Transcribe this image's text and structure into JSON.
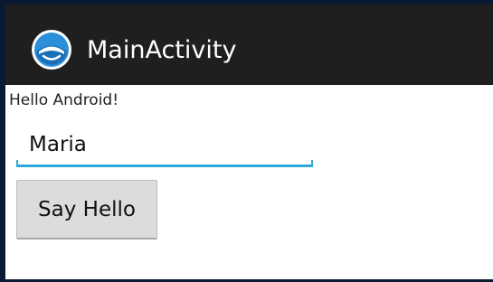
{
  "action_bar": {
    "title": "MainActivity",
    "icon": "app-launcher-icon",
    "background": "#1f1f1f"
  },
  "content": {
    "greeting": "Hello Android!",
    "name_field": {
      "value": "Maria",
      "accent": "#2fa9d6"
    },
    "button_label": "Say Hello"
  }
}
